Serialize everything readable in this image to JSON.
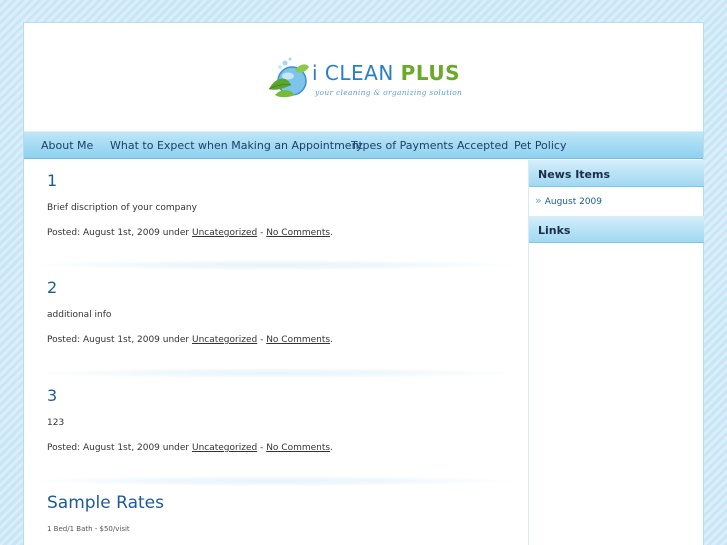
{
  "logo": {
    "title_i": "i",
    "title_clean": "CLEAN",
    "title_plus": "PLUS",
    "tagline": "your cleaning & organizing solution"
  },
  "nav": {
    "items": [
      {
        "label": "About Me"
      },
      {
        "label": "What to Expect when Making an Appointment"
      },
      {
        "label": "Types of Payments Accepted"
      },
      {
        "label": "Pet Policy"
      }
    ]
  },
  "posts": [
    {
      "title": "1",
      "body": "Brief discription of your company",
      "meta_prefix": "Posted: August 1st, 2009 under ",
      "category": "Uncategorized",
      "sep": " - ",
      "comments": "No Comments",
      "end": "."
    },
    {
      "title": "2",
      "body": "additional info",
      "meta_prefix": "Posted: August 1st, 2009 under ",
      "category": "Uncategorized",
      "sep": " - ",
      "comments": "No Comments",
      "end": "."
    },
    {
      "title": "3",
      "body": "123",
      "meta_prefix": "Posted: August 1st, 2009 under ",
      "category": "Uncategorized",
      "sep": " - ",
      "comments": "No Comments",
      "end": "."
    }
  ],
  "sample_rates": {
    "title": "Sample Rates",
    "line": "1 Bed/1 Bath - $50/visit"
  },
  "sidebar": {
    "news_title": "News Items",
    "news_arrow": "»",
    "news_link": "August 2009",
    "links_title": "Links"
  },
  "colors": {
    "accent": "#1d5a98",
    "nav_bg": "#a8dcf4",
    "brand_blue": "#2a7fc4",
    "brand_green": "#6aaa2a"
  }
}
